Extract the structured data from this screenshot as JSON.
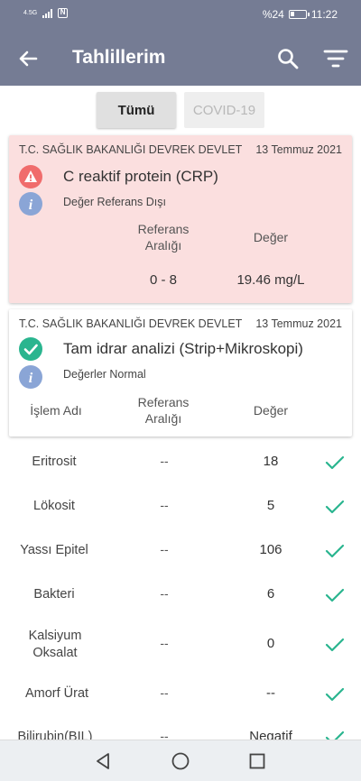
{
  "status_bar": {
    "signal_text": "4.5G",
    "battery_text": "%24",
    "battery_level": 0.24,
    "time": "11:22"
  },
  "app_bar": {
    "title": "Tahlillerim",
    "back_icon": "arrow-left-icon",
    "search_icon": "search-icon",
    "filter_icon": "filter-icon"
  },
  "tabs": [
    {
      "label": "Tümü",
      "active": true
    },
    {
      "label": "COVID-19",
      "active": false
    }
  ],
  "cards": [
    {
      "institution": "T.C. SAĞLIK BAKANLIĞI DEVREK DEVLET",
      "date": "13 Temmuz 2021",
      "test_name": "C reaktif protein (CRP)",
      "status": "Değer Referans Dışı",
      "status_icon": "warning-icon",
      "info_icon": "info-icon",
      "col_ref": "Referans Aralığı",
      "col_value": "Değer",
      "ref_value": "0 - 8",
      "value": "19.46 mg/L",
      "accent": "#f06c6c"
    },
    {
      "institution": "T.C. SAĞLIK BAKANLIĞI DEVREK DEVLET",
      "date": "13 Temmuz 2021",
      "test_name": "Tam idrar analizi (Strip+Mikroskopi)",
      "status": "Değerler Normal",
      "status_icon": "check-circle-icon",
      "info_icon": "info-icon",
      "col_name": "İşlem Adı",
      "col_ref": "Referans Aralığı",
      "col_value": "Değer",
      "accent": "#2ab58f"
    }
  ],
  "results": [
    {
      "name": "Eritrosit",
      "ref": "--",
      "value": "18"
    },
    {
      "name": "Lökosit",
      "ref": "--",
      "value": "5"
    },
    {
      "name": "Yassı Epitel",
      "ref": "--",
      "value": "106"
    },
    {
      "name": "Bakteri",
      "ref": "--",
      "value": "6"
    },
    {
      "name": "Kalsiyum Oksalat",
      "ref": "--",
      "value": "0"
    },
    {
      "name": "Amorf Ürat",
      "ref": "--",
      "value": "--"
    },
    {
      "name": "Bilirubin(BIL)",
      "ref": "--",
      "value": "Negatif"
    }
  ],
  "colors": {
    "app_bar": "#757c94",
    "check": "#2ab58f",
    "info": "#8aa5d6",
    "warning": "#f06c6c",
    "alert_card": "#fbdfdf"
  }
}
